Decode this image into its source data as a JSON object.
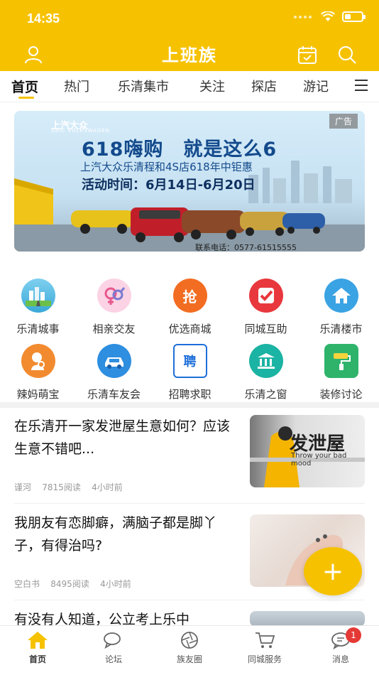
{
  "status_bar": {
    "time": "14:35"
  },
  "header": {
    "logo": "上班族",
    "user_icon": "user-icon",
    "calendar_icon": "calendar-icon",
    "search_icon": "search-icon"
  },
  "tabs": [
    {
      "label": "首页",
      "active": true
    },
    {
      "label": "热门"
    },
    {
      "label": "乐清集市"
    },
    {
      "label": "关注"
    },
    {
      "label": "探店"
    },
    {
      "label": "游记"
    }
  ],
  "banner": {
    "ad_tag": "广告",
    "brand": "上汽大众",
    "brand_en": "SAIC VOLKSWAGEN",
    "headline": "618嗨购　就是这么6",
    "subline": "上汽大众乐清程和4S店618年中钜惠",
    "dates": "活动时间：6月14日-6月20日",
    "phone": "联系电话：0577-61515555"
  },
  "grid": [
    {
      "label": "乐清城事",
      "icon": "city-icon",
      "color": "#5cc0e8"
    },
    {
      "label": "相亲交友",
      "icon": "gender-icon",
      "color": "#f6a6c6"
    },
    {
      "label": "优选商城",
      "icon": "grab-icon",
      "glyph": "抢",
      "color": "#f26d21"
    },
    {
      "label": "同城互助",
      "icon": "check-icon",
      "color": "#e8383d"
    },
    {
      "label": "乐清楼市",
      "icon": "house-icon",
      "color": "#3aa3e3"
    },
    {
      "label": "辣妈萌宝",
      "icon": "mom-baby-icon",
      "color": "#f28b30"
    },
    {
      "label": "乐清车友会",
      "icon": "car-icon",
      "color": "#2e8ee0"
    },
    {
      "label": "招聘求职",
      "icon": "recruit-icon",
      "glyph": "聘",
      "color": "#1e6fd9"
    },
    {
      "label": "乐清之窗",
      "icon": "building-icon",
      "color": "#1bb3a3"
    },
    {
      "label": "装修讨论",
      "icon": "paint-roller-icon",
      "color": "#2fb36b"
    }
  ],
  "articles": [
    {
      "title": "在乐清开一家发泄屋生意如何？应该生意不错吧...",
      "author": "谨河",
      "reads": "7815阅读",
      "time": "4小时前",
      "thumb_text": "发泄屋",
      "thumb_sub": "Throw your bad mood"
    },
    {
      "title": "我朋友有恋脚癖，满脑子都是脚丫子，有得治吗?",
      "author": "空白书",
      "reads": "8495阅读",
      "time": "4小时前"
    },
    {
      "title": "有没有人知道，公立考上乐中"
    }
  ],
  "fab": {
    "label": "+"
  },
  "bottom_nav": [
    {
      "label": "首页",
      "icon": "home-icon",
      "active": true
    },
    {
      "label": "论坛",
      "icon": "chat-bubbles-icon"
    },
    {
      "label": "族友圈",
      "icon": "aperture-icon"
    },
    {
      "label": "同城服务",
      "icon": "cart-icon"
    },
    {
      "label": "消息",
      "icon": "message-icon",
      "badge": "1"
    }
  ],
  "colors": {
    "accent": "#f6c200",
    "badge": "#e53935"
  }
}
